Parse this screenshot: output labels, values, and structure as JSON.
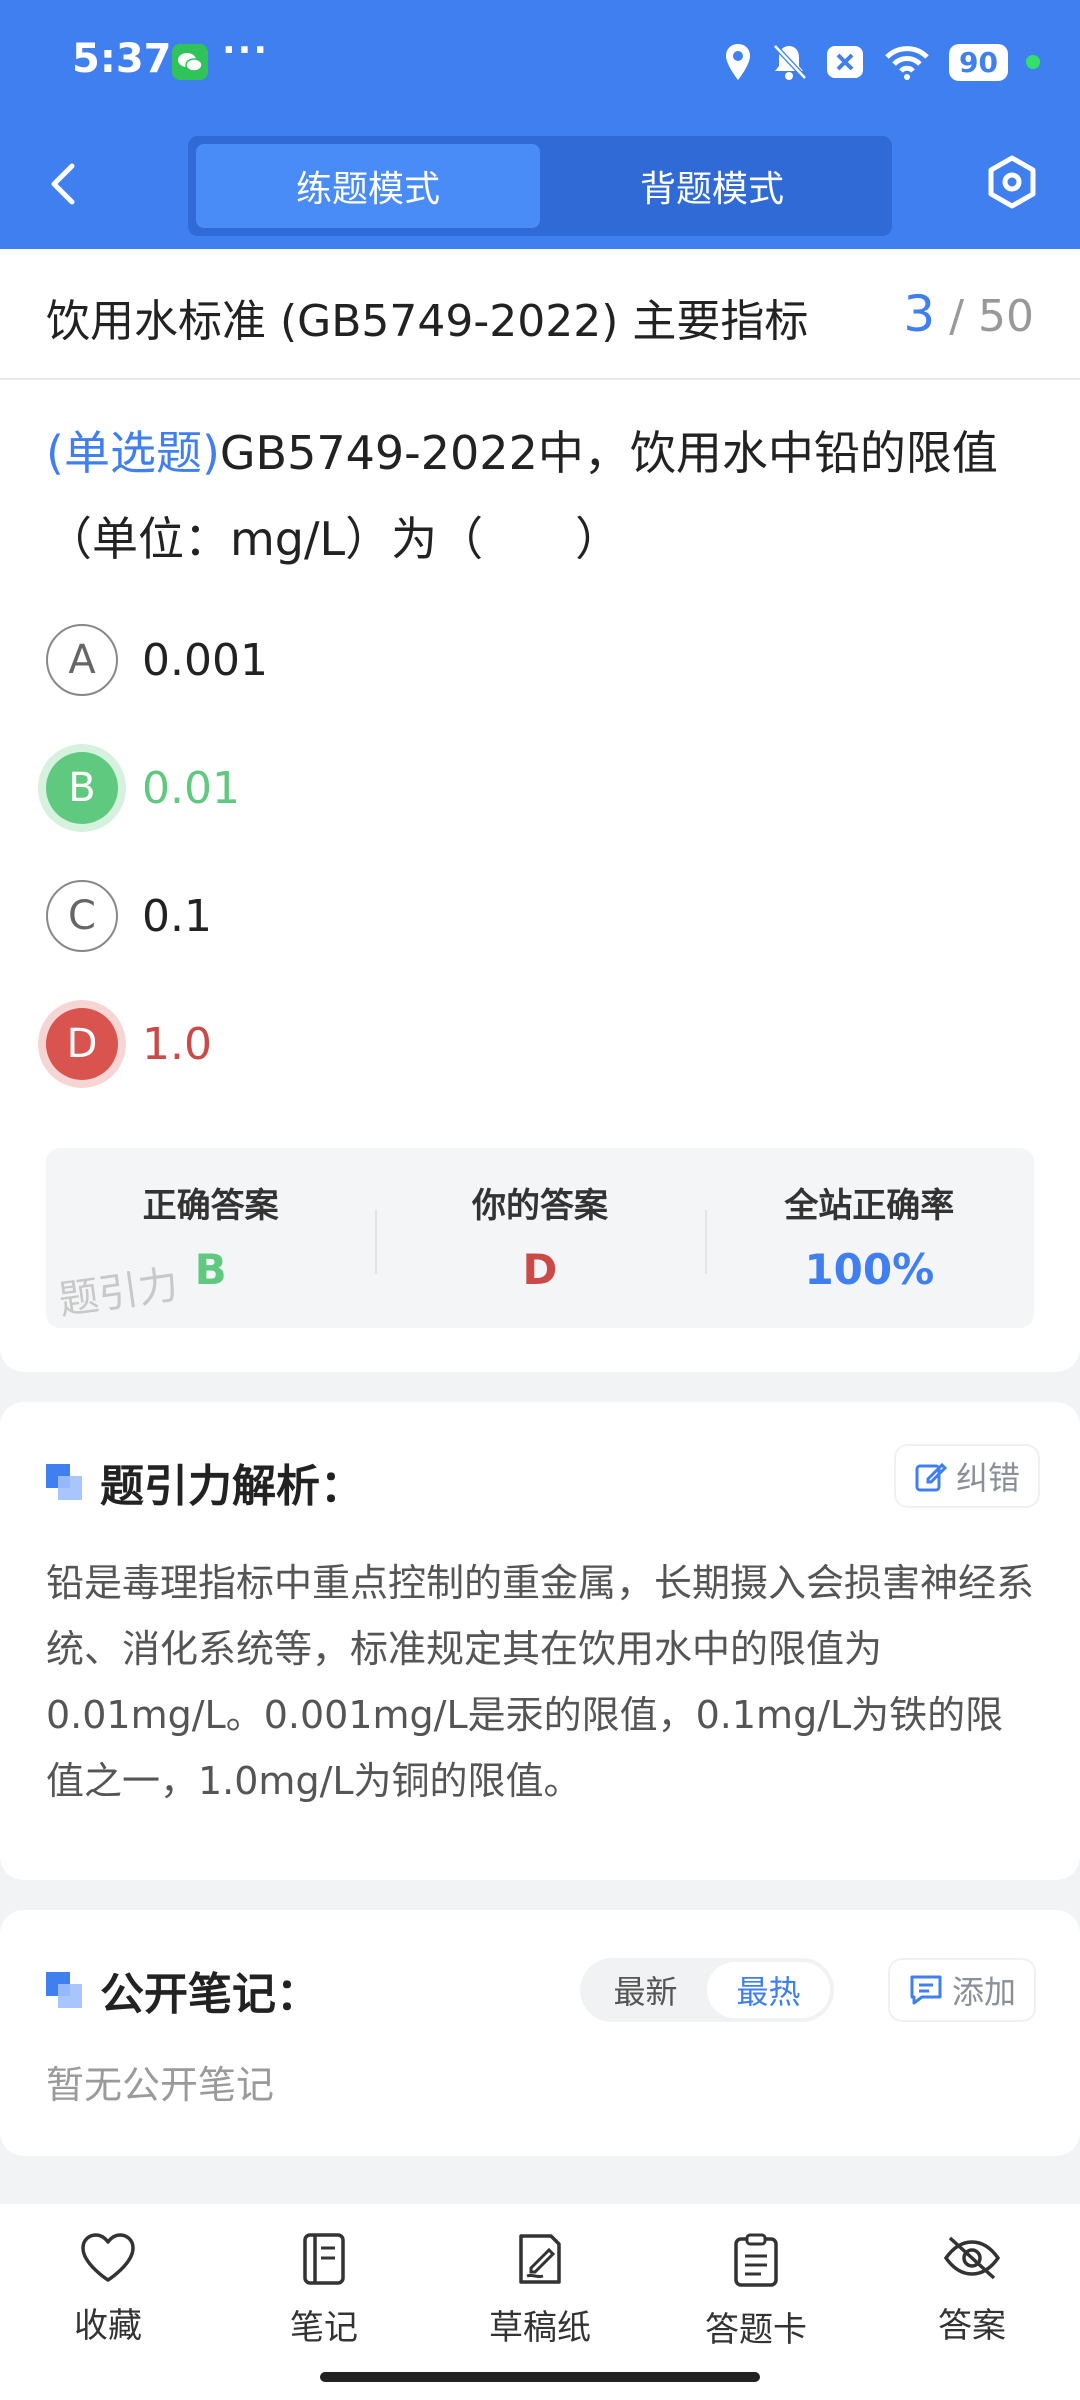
{
  "status_bar": {
    "time": "5:37",
    "more": "···",
    "battery": "90"
  },
  "header": {
    "modes": [
      {
        "label": "练题模式",
        "active": true
      },
      {
        "label": "背题模式",
        "active": false
      }
    ]
  },
  "question_header": {
    "title": "饮用水标准 (GB5749-2022) 主要指标",
    "current": "3",
    "total": "/ 50"
  },
  "question": {
    "type": "(单选题)",
    "text": "GB5749-2022中，饮用水中铅的限值（单位：mg/L）为（　　）",
    "options": [
      {
        "letter": "A",
        "text": "0.001",
        "state": "normal"
      },
      {
        "letter": "B",
        "text": "0.01",
        "state": "correct"
      },
      {
        "letter": "C",
        "text": "0.1",
        "state": "normal"
      },
      {
        "letter": "D",
        "text": "1.0",
        "state": "wrong"
      }
    ]
  },
  "result": {
    "correct_label": "正确答案",
    "correct_value": "B",
    "yours_label": "你的答案",
    "yours_value": "D",
    "rate_label": "全站正确率",
    "rate_value": "100%",
    "watermark": "题引力"
  },
  "analysis": {
    "title": "题引力解析：",
    "report_label": "纠错",
    "text": "铅是毒理指标中重点控制的重金属，长期摄入会损害神经系统、消化系统等，标准规定其在饮用水中的限值为0.01mg/L。0.001mg/L是汞的限值，0.1mg/L为铁的限值之一，1.0mg/L为铜的限值。"
  },
  "notes": {
    "title": "公开笔记：",
    "sort_options": [
      "最新",
      "最热"
    ],
    "sort_active": "最热",
    "add_label": "添加",
    "empty_text": "暂无公开笔记"
  },
  "bottom_nav": [
    {
      "label": "收藏",
      "icon": "heart-icon"
    },
    {
      "label": "笔记",
      "icon": "notebook-icon"
    },
    {
      "label": "草稿纸",
      "icon": "draft-icon"
    },
    {
      "label": "答题卡",
      "icon": "answer-card-icon"
    },
    {
      "label": "答案",
      "icon": "eye-off-icon"
    }
  ],
  "colors": {
    "primary": "#3f7ff0",
    "correct": "#5fc97f",
    "wrong": "#d9534f"
  }
}
